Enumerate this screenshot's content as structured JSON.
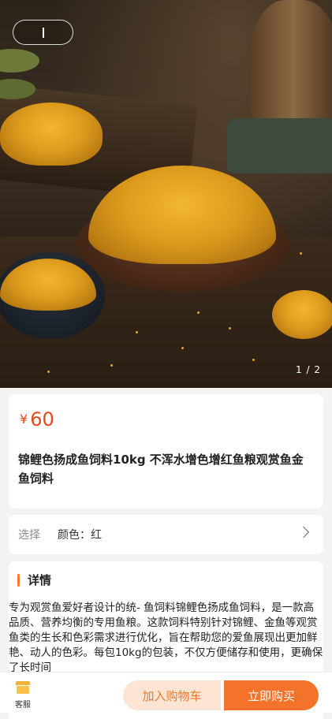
{
  "gallery": {
    "pager": "1 / 2"
  },
  "product": {
    "price_symbol": "¥",
    "price": "60",
    "title": "锦鲤色扬成鱼饲料10kg 不浑水增色增红鱼粮观赏鱼金鱼饲料"
  },
  "selection": {
    "label": "选择",
    "value": "颜色：红"
  },
  "details": {
    "heading": "详情",
    "text": "专为观赏鱼爱好者设计的统- 鱼饲料锦鲤色扬成鱼饲料，是一款高品质、营养均衡的专用鱼粮。这款饲料特别针对锦鲤、金鱼等观赏鱼类的生长和色彩需求进行优化，旨在帮助您的爱鱼展现出更加鲜艳、动人的色彩。每包10kg的包装，不仅方便储存和使用，更确保了长时间"
  },
  "bottom_bar": {
    "service_label": "客服",
    "add_to_cart": "加入购物车",
    "buy_now": "立即购买"
  },
  "colors": {
    "price": "#e8461e",
    "accent": "#f07a2a",
    "buy_button": "#f5722a",
    "cart_button_bg": "#fde4d3"
  }
}
